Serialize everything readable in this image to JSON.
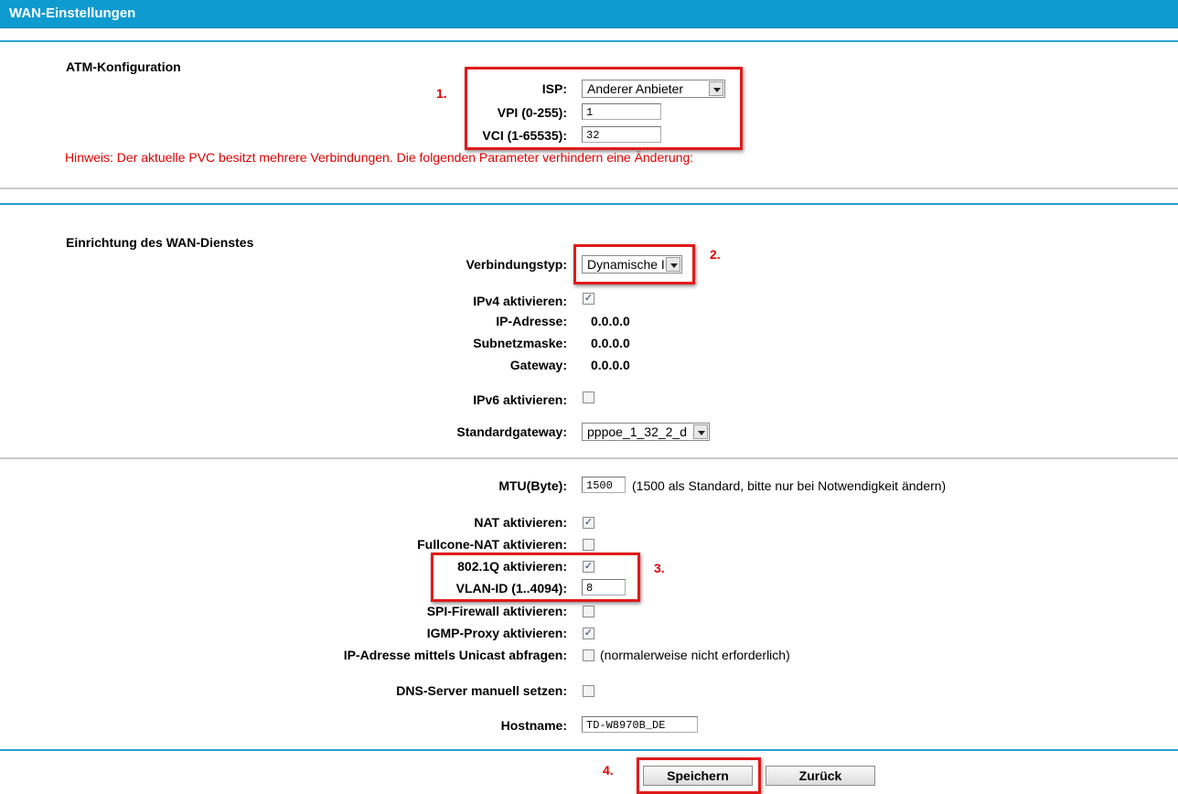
{
  "header": {
    "title": "WAN-Einstellungen"
  },
  "atm": {
    "title": "ATM-Konfiguration",
    "isp_label": "ISP:",
    "isp_value": "Anderer Anbieter",
    "vpi_label": "VPI (0-255):",
    "vpi_value": "1",
    "vci_label": "VCI (1-65535):",
    "vci_value": "32",
    "hint": "Hinweis: Der aktuelle PVC besitzt mehrere Verbindungen. Die folgenden Parameter verhindern eine Änderung:"
  },
  "wan": {
    "title": "Einrichtung des WAN-Dienstes",
    "conn_type_label": "Verbindungstyp:",
    "conn_type_value": "Dynamische IP",
    "ipv4_label": "IPv4 aktivieren:",
    "ipv4_checked": true,
    "ip_label": "IP-Adresse:",
    "ip_value": "0.0.0.0",
    "subnet_label": "Subnetzmaske:",
    "subnet_value": "0.0.0.0",
    "gateway_label": "Gateway:",
    "gateway_value": "0.0.0.0",
    "ipv6_label": "IPv6 aktivieren:",
    "ipv6_checked": false,
    "default_gw_label": "Standardgateway:",
    "default_gw_value": "pppoe_1_32_2_d"
  },
  "advanced": {
    "mtu_label": "MTU(Byte):",
    "mtu_value": "1500",
    "mtu_note": "(1500 als Standard, bitte nur bei Notwendigkeit ändern)",
    "nat_label": "NAT aktivieren:",
    "nat_checked": true,
    "fullcone_label": "Fullcone-NAT aktivieren:",
    "fullcone_checked": false,
    "dot1q_label": "802.1Q aktivieren:",
    "dot1q_checked": true,
    "vlan_label": "VLAN-ID (1..4094):",
    "vlan_value": "8",
    "spi_label": "SPI-Firewall aktivieren:",
    "spi_checked": false,
    "igmp_label": "IGMP-Proxy aktivieren:",
    "igmp_checked": true,
    "unicast_label": "IP-Adresse mittels Unicast abfragen:",
    "unicast_checked": false,
    "unicast_note": "(normalerweise nicht erforderlich)",
    "dns_label": "DNS-Server manuell setzen:",
    "dns_checked": false,
    "hostname_label": "Hostname:",
    "hostname_value": "TD-W8970B_DE"
  },
  "buttons": {
    "save": "Speichern",
    "back": "Zurück"
  },
  "markers": {
    "m1": "1.",
    "m2": "2.",
    "m3": "3.",
    "m4": "4."
  },
  "colors": {
    "header_bg": "#0e9bd0",
    "highlight": "#e11a1a",
    "hint_text": "#e00000"
  }
}
